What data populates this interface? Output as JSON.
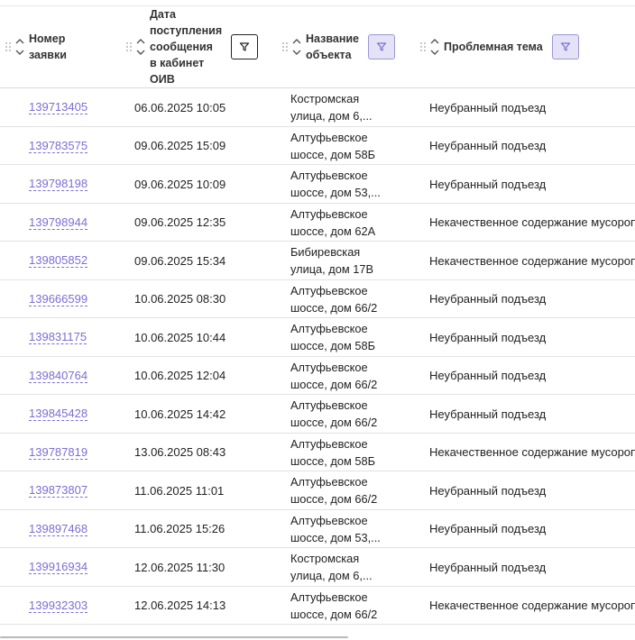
{
  "table": {
    "columns": [
      {
        "id": "number",
        "title": "Номер\nзаявки"
      },
      {
        "id": "date",
        "title": "Дата\nпоступления\nсообщения\nв кабинет\nОИВ"
      },
      {
        "id": "object",
        "title": "Название\nобъекта"
      },
      {
        "id": "topic",
        "title": "Проблемная тема"
      }
    ],
    "rows": [
      {
        "number": "139713405",
        "date": "06.06.2025 10:05",
        "object": "Костромская\nулица, дом 6,...",
        "topic": "Неубранный подъезд"
      },
      {
        "number": "139783575",
        "date": "09.06.2025 15:09",
        "object": "Алтуфьевское\nшоссе, дом 58Б",
        "topic": "Неубранный подъезд"
      },
      {
        "number": "139798198",
        "date": "09.06.2025 10:09",
        "object": "Алтуфьевское\nшоссе, дом 53,...",
        "topic": "Неубранный подъезд"
      },
      {
        "number": "139798944",
        "date": "09.06.2025 12:35",
        "object": "Алтуфьевское\nшоссе, дом 62А",
        "topic": "Некачественное содержание мусороп"
      },
      {
        "number": "139805852",
        "date": "09.06.2025 15:34",
        "object": "Бибиревская\nулица, дом 17В",
        "topic": "Некачественное содержание мусороп"
      },
      {
        "number": "139666599",
        "date": "10.06.2025 08:30",
        "object": "Алтуфьевское\nшоссе, дом 66/2",
        "topic": "Неубранный подъезд"
      },
      {
        "number": "139831175",
        "date": "10.06.2025 10:44",
        "object": "Алтуфьевское\nшоссе, дом 58Б",
        "topic": "Неубранный подъезд"
      },
      {
        "number": "139840764",
        "date": "10.06.2025 12:04",
        "object": "Алтуфьевское\nшоссе, дом 66/2",
        "topic": "Неубранный подъезд"
      },
      {
        "number": "139845428",
        "date": "10.06.2025 14:42",
        "object": "Алтуфьевское\nшоссе, дом 66/2",
        "topic": "Неубранный подъезд"
      },
      {
        "number": "139787819",
        "date": "13.06.2025 08:43",
        "object": "Алтуфьевское\nшоссе, дом 58Б",
        "topic": "Некачественное содержание мусороп"
      },
      {
        "number": "139873807",
        "date": "11.06.2025 11:01",
        "object": "Алтуфьевское\nшоссе, дом 66/2",
        "topic": "Неубранный подъезд"
      },
      {
        "number": "139897468",
        "date": "11.06.2025 15:26",
        "object": "Алтуфьевское\nшоссе, дом 53,...",
        "topic": "Неубранный подъезд"
      },
      {
        "number": "139916934",
        "date": "12.06.2025 11:30",
        "object": "Костромская\nулица, дом 6,...",
        "topic": "Неубранный подъезд"
      },
      {
        "number": "139932303",
        "date": "12.06.2025 14:13",
        "object": "Алтуфьевское\nшоссе, дом 66/2",
        "topic": "Некачественное содержание мусороп"
      }
    ]
  },
  "icons": {
    "drag": "drag-handle-icon",
    "sort": "sort-up-down-icon",
    "filter": "filter-icon"
  },
  "colors": {
    "link": "#7b6fd4",
    "filter_purple_bg": "#e4e2f7",
    "filter_purple_border": "#9d97d6"
  }
}
